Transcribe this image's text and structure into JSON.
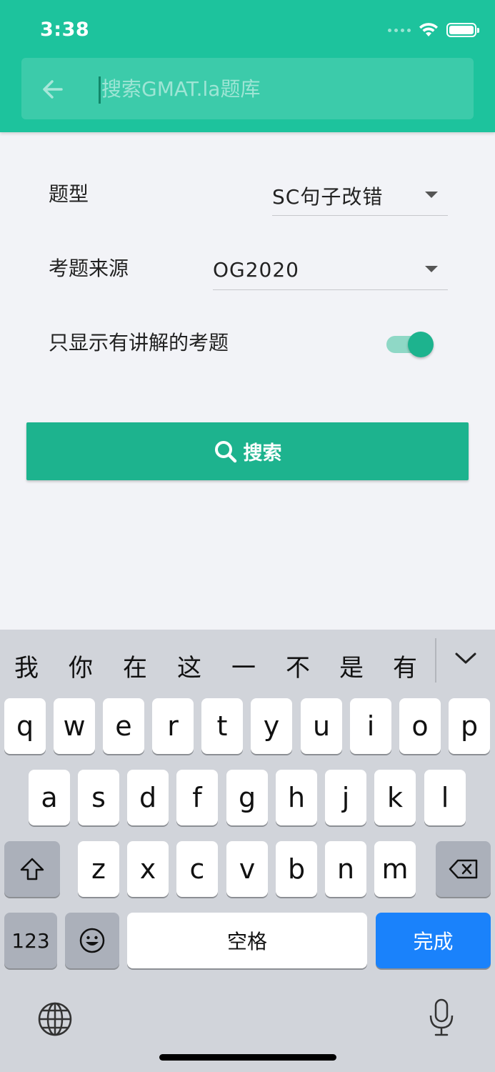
{
  "status": {
    "time": "3:38"
  },
  "search": {
    "placeholder": "搜索GMAT.la题库"
  },
  "form": {
    "type_label": "题型",
    "type_value": "SC句子改错",
    "source_label": "考题来源",
    "source_value": "OG2020",
    "explained_label": "只显示有讲解的考题",
    "explained_on": true
  },
  "search_button": {
    "label": "搜索"
  },
  "keyboard": {
    "candidates": [
      "我",
      "你",
      "在",
      "这",
      "一",
      "不",
      "是",
      "有"
    ],
    "row1": [
      "q",
      "w",
      "e",
      "r",
      "t",
      "y",
      "u",
      "i",
      "o",
      "p"
    ],
    "row2": [
      "a",
      "s",
      "d",
      "f",
      "g",
      "h",
      "j",
      "k",
      "l"
    ],
    "row3": [
      "z",
      "x",
      "c",
      "v",
      "b",
      "n",
      "m"
    ],
    "numbers_label": "123",
    "space_label": "空格",
    "done_label": "完成"
  },
  "colors": {
    "primary": "#1dc39d",
    "button": "#1db38e",
    "done_key": "#1a82fb"
  }
}
